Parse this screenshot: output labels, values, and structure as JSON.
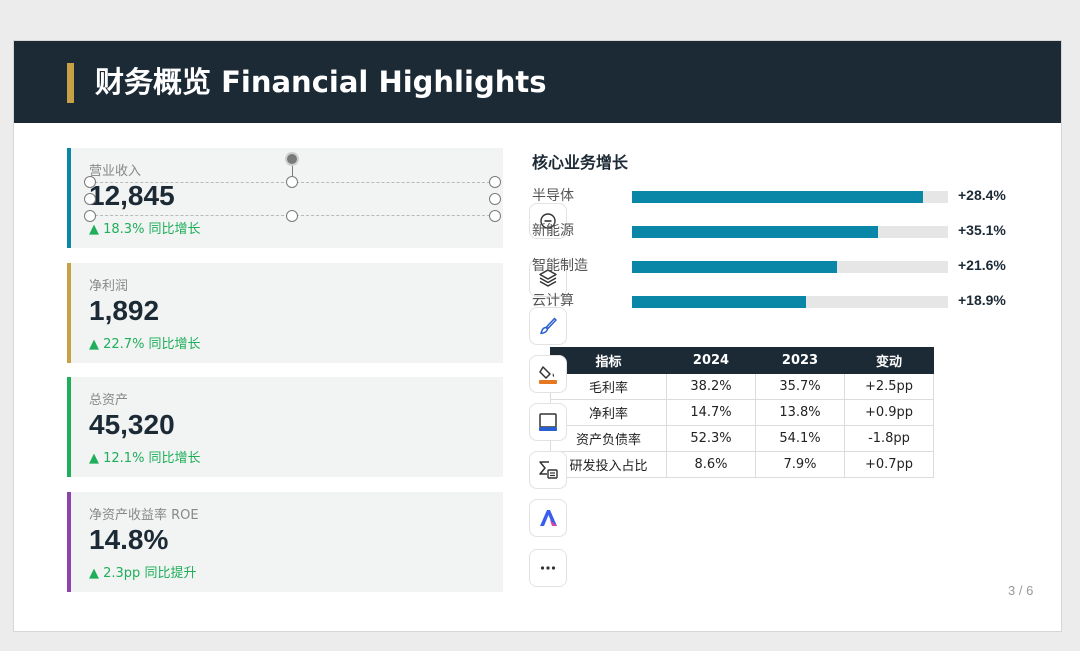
{
  "slide": {
    "title": "财务概览 Financial Highlights",
    "page_number": "3 / 6"
  },
  "kpis": [
    {
      "label": "营业收入",
      "value": "12,845",
      "change": "▲ 18.3% 同比增长",
      "color": "#0a86a6"
    },
    {
      "label": "净利润",
      "value": "1,892",
      "change": "▲ 22.7% 同比增长",
      "color": "#c8a145"
    },
    {
      "label": "总资产",
      "value": "45,320",
      "change": "▲ 12.1% 同比增长",
      "color": "#1fae5a"
    },
    {
      "label": "净资产收益率 ROE",
      "value": "14.8%",
      "change": "▲ 2.3pp 同比提升",
      "color": "#8e44ad"
    }
  ],
  "growth_chart": {
    "title": "核心业务增长",
    "bar_color": "#0a86a6",
    "track_color": "#e6e6e6"
  },
  "chart_data": {
    "type": "bar",
    "orientation": "horizontal",
    "title": "核心业务增长",
    "categories": [
      "半导体",
      "新能源",
      "智能制造",
      "云计算"
    ],
    "value_labels": [
      "+28.4%",
      "+35.1%",
      "+21.6%",
      "+18.9%"
    ],
    "bar_fill_fraction": [
      0.92,
      0.78,
      0.65,
      0.55
    ]
  },
  "table": {
    "headers": [
      "指标",
      "2024",
      "2023",
      "变动"
    ],
    "rows": [
      [
        "毛利率",
        "38.2%",
        "35.7%",
        "+2.5pp"
      ],
      [
        "净利率",
        "14.7%",
        "13.8%",
        "+0.9pp"
      ],
      [
        "资产负债率",
        "52.3%",
        "54.1%",
        "-1.8pp"
      ],
      [
        "研发投入占比",
        "8.6%",
        "7.9%",
        "+0.7pp"
      ]
    ]
  },
  "toolbar": {
    "tools": [
      "minus-icon",
      "layers-icon",
      "brush-icon",
      "fill-bucket-icon",
      "monitor-icon",
      "formula-icon",
      "ai-logo-icon",
      "more-icon"
    ]
  },
  "colors": {
    "header_bg": "#1c2a36",
    "accent_gold": "#c8a145",
    "positive": "#1fae5a"
  }
}
